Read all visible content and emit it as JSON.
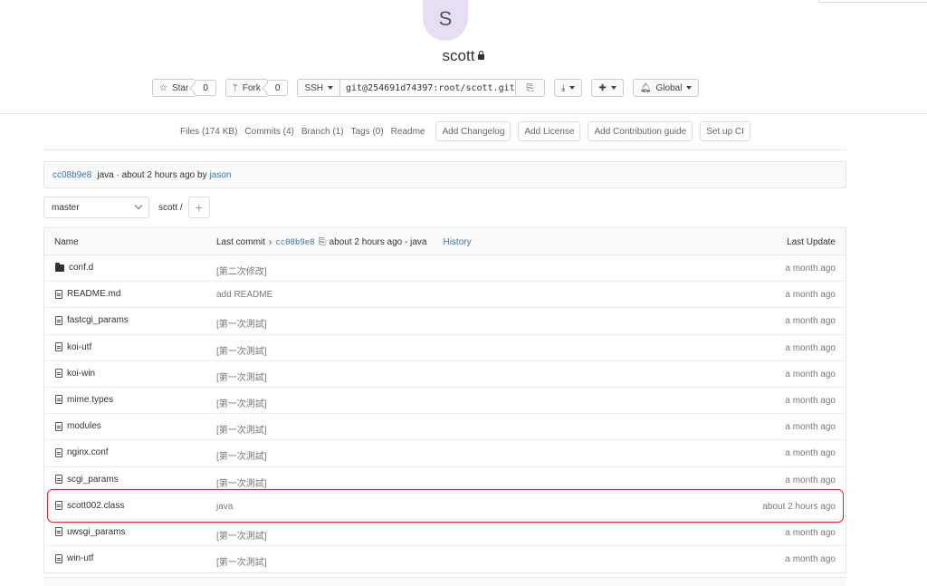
{
  "project": {
    "avatar_letter": "S",
    "name": "scott"
  },
  "actions": {
    "star_label": "Star",
    "star_count": "0",
    "fork_label": "Fork",
    "fork_count": "0",
    "protocol": "SSH",
    "clone_url": "git@254691d74397:root/scott.git",
    "global_label": "Global"
  },
  "stats": {
    "files": "Files (174 KB)",
    "commits": "Commits (4)",
    "branch": "Branch (1)",
    "tags": "Tags (0)",
    "readme": "Readme",
    "add_changelog": "Add Changelog",
    "add_license": "Add License",
    "add_contribution": "Add Contribution guide",
    "setup_ci": "Set up CI"
  },
  "commit_bar": {
    "sha": "cc08b9e8",
    "message": "java · about 2 hours ago by",
    "author": "jason"
  },
  "nav": {
    "branch": "master",
    "path": "scott",
    "path_sep": "/",
    "plus": "+"
  },
  "tree": {
    "header": {
      "name": "Name",
      "last_commit": "Last commit",
      "sha": "cc08b9e8",
      "when": "about 2 hours ago - java",
      "history": "History",
      "last_update": "Last Update"
    },
    "rows": [
      {
        "name": "conf.d",
        "type": "folder",
        "message": "[第二次修改]",
        "date": "a month ago"
      },
      {
        "name": "README.md",
        "type": "file",
        "message": "add README",
        "date": "a month ago"
      },
      {
        "name": "fastcgi_params",
        "type": "file",
        "message": "[第一次測試]",
        "date": "a month ago"
      },
      {
        "name": "koi-utf",
        "type": "file",
        "message": "[第一次測試]",
        "date": "a month ago"
      },
      {
        "name": "koi-win",
        "type": "file",
        "message": "[第一次測試]",
        "date": "a month ago"
      },
      {
        "name": "mime.types",
        "type": "file",
        "message": "[第一次測試]",
        "date": "a month ago"
      },
      {
        "name": "modules",
        "type": "file",
        "message": "[第一次測試]",
        "date": "a month ago"
      },
      {
        "name": "nginx.conf",
        "type": "file",
        "message": "[第一次測試]",
        "date": "a month ago"
      },
      {
        "name": "scgi_params",
        "type": "file",
        "message": "[第一次測試]",
        "date": "a month ago"
      },
      {
        "name": "scott002.class",
        "type": "file",
        "message": "java",
        "date": "about 2 hours ago"
      },
      {
        "name": "uwsgi_params",
        "type": "file",
        "message": "[第一次測試]",
        "date": "a month ago"
      },
      {
        "name": "win-utf",
        "type": "file",
        "message": "[第一次測試]",
        "date": "a month ago"
      }
    ]
  },
  "colors": {
    "link": "#3777b0",
    "highlight": "#e0242d",
    "avatar_bg": "#e8def4"
  }
}
